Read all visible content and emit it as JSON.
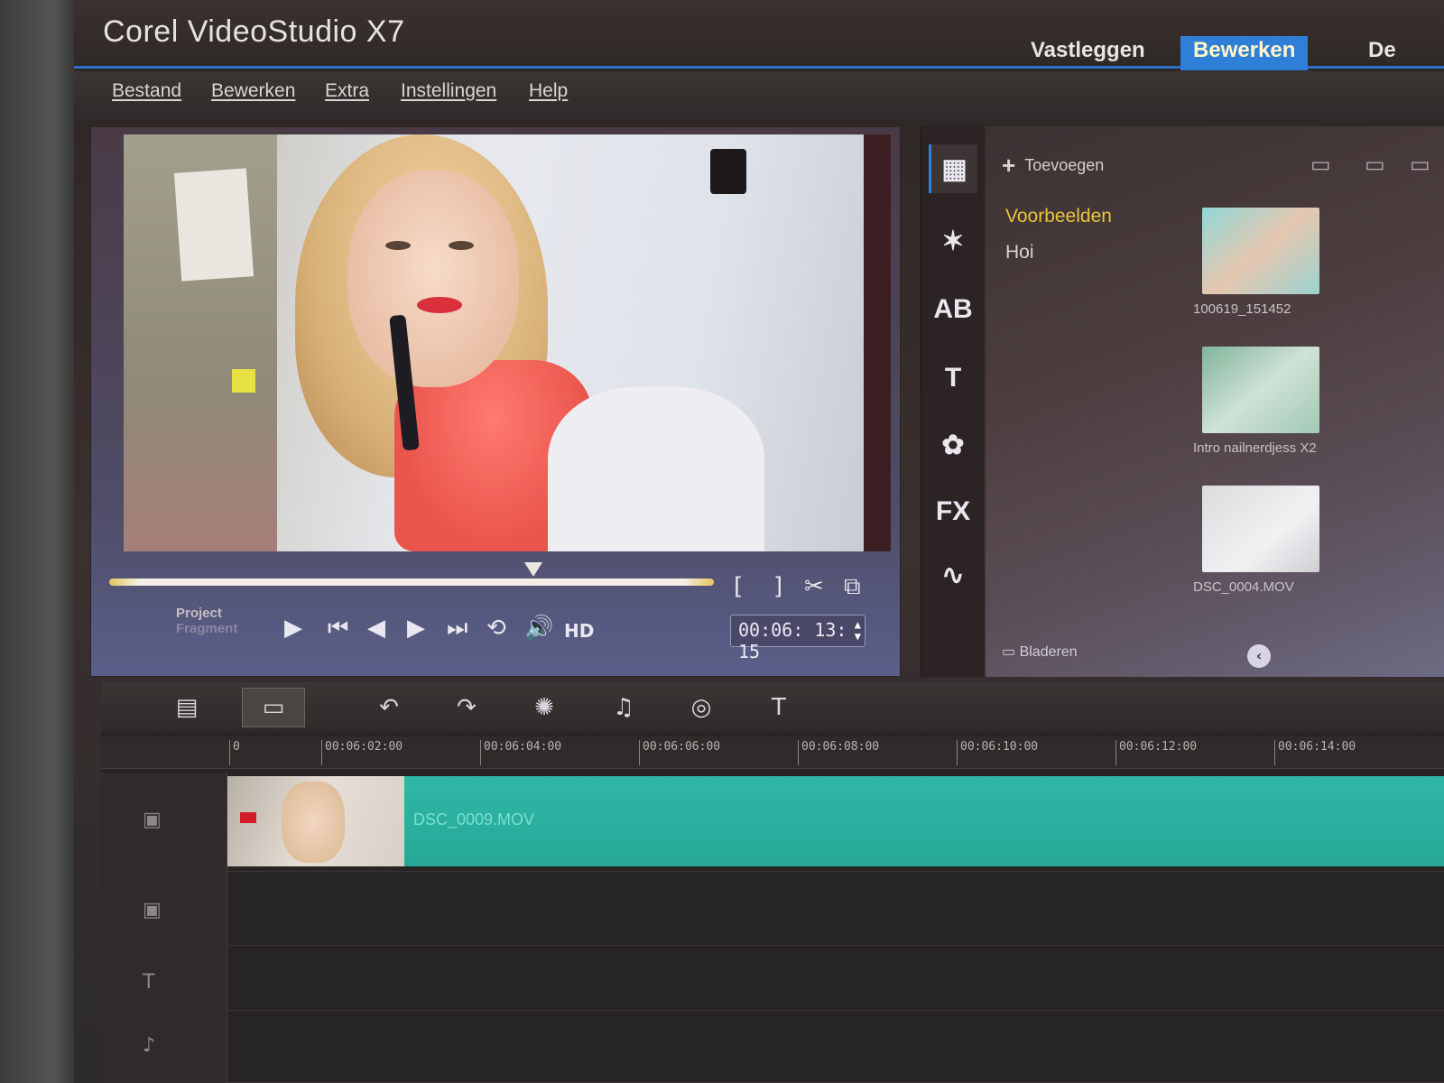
{
  "app": {
    "title": "Corel VideoStudio X7",
    "step_tabs": [
      {
        "label": "Vastleggen",
        "active": false
      },
      {
        "label": "Bewerken",
        "active": true
      },
      {
        "label": "De",
        "active": false
      }
    ]
  },
  "menu": {
    "items": [
      "Bestand",
      "Bewerken",
      "Extra",
      "Instellingen",
      "Help"
    ]
  },
  "preview": {
    "mode_project": "Project",
    "mode_fragment": "Fragment",
    "hd_label": "HD",
    "timecode": "00:06: 13: 15",
    "mark_in": "[",
    "mark_out": "]"
  },
  "library": {
    "add_label": "Toevoegen",
    "folders": [
      {
        "label": "Voorbeelden",
        "selected": true
      },
      {
        "label": "Hoi",
        "selected": false
      }
    ],
    "thumbnails": [
      {
        "caption": "100619_151452"
      },
      {
        "caption": "Intro nailnerdjess X2"
      },
      {
        "caption": "DSC_0004.MOV"
      }
    ],
    "browse_label": "Bladeren",
    "sidebar_icons": [
      "media-icon",
      "instant-project-icon",
      "transition-icon",
      "title-icon",
      "graphic-icon",
      "filter-icon",
      "path-icon"
    ],
    "sidebar_glyphs": [
      "▦",
      "✶",
      "AB",
      "T",
      "✿",
      "FX",
      "∿"
    ]
  },
  "timeline": {
    "ruler": [
      "0",
      "00:06:02:00",
      "00:06:04:00",
      "00:06:06:00",
      "00:06:08:00",
      "00:06:10:00",
      "00:06:12:00",
      "00:06:14:00"
    ],
    "clip_name": "DSC_0009.MOV",
    "toolbar_glyphs": [
      "▤",
      "▭",
      "↶",
      "↷",
      "✺",
      "♫",
      "◎",
      "T"
    ]
  },
  "colors": {
    "accent": "#2f7ed8",
    "selected_folder": "#e8c53c",
    "clip": "#2fb7a6"
  }
}
